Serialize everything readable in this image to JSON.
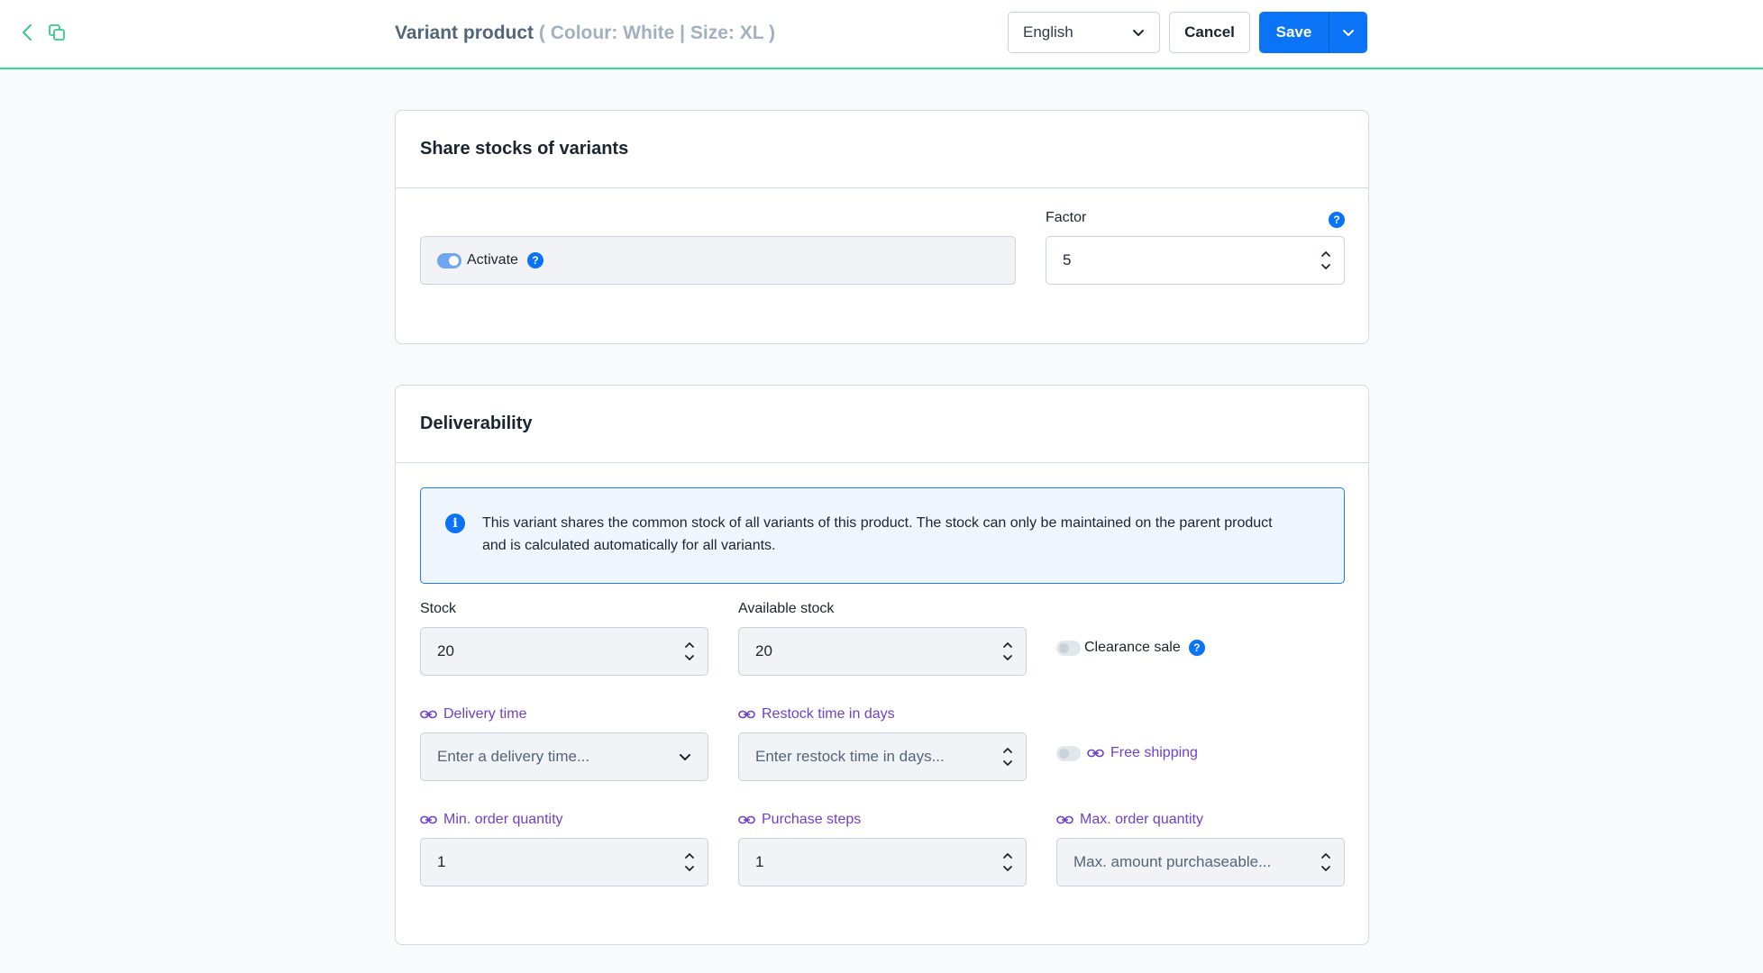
{
  "header": {
    "title": "Variant product",
    "subtitle": "( Colour: White | Size: XL )",
    "language": "English",
    "cancel_label": "Cancel",
    "save_label": "Save"
  },
  "share_stocks": {
    "title": "Share stocks of variants",
    "activate_label": "Activate",
    "activate_on": true,
    "factor_label": "Factor",
    "factor_value": "5"
  },
  "deliverability": {
    "title": "Deliverability",
    "info_text": "This variant shares the common stock of all variants of this product. The stock can only be maintained on the parent product and is calculated automatically for all variants.",
    "stock_label": "Stock",
    "stock_value": "20",
    "available_stock_label": "Available stock",
    "available_stock_value": "20",
    "clearance_sale_label": "Clearance sale",
    "delivery_time_label": "Delivery time",
    "delivery_time_placeholder": "Enter a delivery time...",
    "restock_label": "Restock time in days",
    "restock_placeholder": "Enter restock time in days...",
    "free_shipping_label": "Free shipping",
    "min_order_label": "Min. order quantity",
    "min_order_value": "1",
    "purchase_steps_label": "Purchase steps",
    "purchase_steps_value": "1",
    "max_order_label": "Max. order quantity",
    "max_order_placeholder": "Max. amount purchaseable..."
  },
  "colors": {
    "accent": "#0b73f5",
    "topbar_border": "#37d88f",
    "inherited_label": "#6e41c9"
  },
  "icons": [
    "back-chevron-icon",
    "copy-icon",
    "chevron-down-icon",
    "help-icon",
    "info-icon",
    "link-icon",
    "stepper-icon"
  ]
}
